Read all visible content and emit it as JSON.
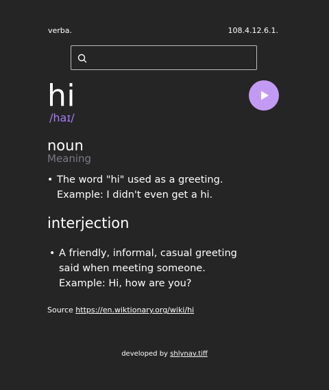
{
  "header": {
    "brand": "verba.",
    "version": "108.4.12.6.1."
  },
  "search": {
    "placeholder": "",
    "value": ""
  },
  "entry": {
    "word": "hi",
    "phonetic": "/haɪ/"
  },
  "meanings": [
    {
      "part_of_speech": "noun",
      "subheading": "Meaning",
      "definitions": [
        {
          "text": "The word \"hi\" used as a greeting.",
          "example": "Example: I didn't even get a hi."
        }
      ]
    },
    {
      "part_of_speech": "interjection",
      "definitions": [
        {
          "text": "A friendly, informal, casual greeting said when meeting someone.",
          "example": "Example: Hi, how are you?"
        }
      ]
    }
  ],
  "source": {
    "label": "Source",
    "url": "https://en.wiktionary.org/wiki/hi"
  },
  "footer": {
    "prefix": "developed by",
    "author": "shlynav.tiff"
  },
  "colors": {
    "background": "#252525",
    "accent": "#a77bf2",
    "play_button": "#c39af3",
    "muted": "#7a7a86"
  },
  "icons": {
    "search": "search-icon",
    "play": "play-icon"
  }
}
